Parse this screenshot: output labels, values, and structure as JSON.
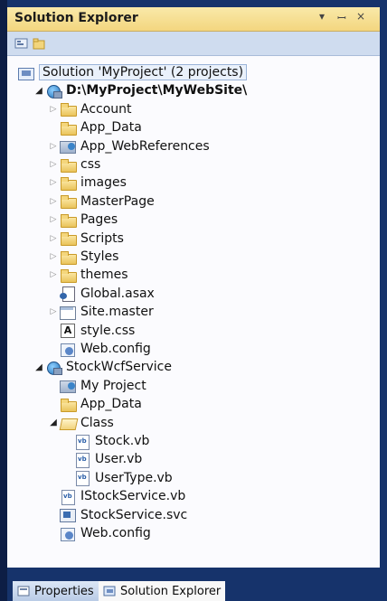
{
  "panel": {
    "title": "Solution Explorer",
    "controls": [
      "▾",
      "ꟷ",
      "×"
    ]
  },
  "toolbar": {
    "buttons": [
      "properties-icon",
      "show-all-files-icon"
    ]
  },
  "tree": {
    "items": [
      {
        "label": "Solution 'MyProject' (2 projects)",
        "level": 0,
        "icon": "solution-icon",
        "selected": true
      },
      {
        "label": "D:\\MyProject\\MyWebSite\\",
        "level": 1,
        "icon": "web-site-icon",
        "expanded": true,
        "bold": true
      },
      {
        "label": "Account",
        "level": 2,
        "icon": "folder-icon",
        "expandable": true
      },
      {
        "label": "App_Data",
        "level": 2,
        "icon": "folder-icon"
      },
      {
        "label": "App_WebReferences",
        "level": 2,
        "icon": "web-references-icon",
        "expandable": true
      },
      {
        "label": "css",
        "level": 2,
        "icon": "folder-icon",
        "expandable": true
      },
      {
        "label": "images",
        "level": 2,
        "icon": "folder-icon",
        "expandable": true
      },
      {
        "label": "MasterPage",
        "level": 2,
        "icon": "folder-icon",
        "expandable": true
      },
      {
        "label": "Pages",
        "level": 2,
        "icon": "folder-icon",
        "expandable": true
      },
      {
        "label": "Scripts",
        "level": 2,
        "icon": "folder-icon",
        "expandable": true
      },
      {
        "label": "Styles",
        "level": 2,
        "icon": "folder-icon",
        "expandable": true
      },
      {
        "label": "themes",
        "level": 2,
        "icon": "folder-icon",
        "expandable": true
      },
      {
        "label": "Global.asax",
        "level": 2,
        "icon": "asax-file-icon"
      },
      {
        "label": "Site.master",
        "level": 2,
        "icon": "master-file-icon",
        "expandable": true
      },
      {
        "label": "style.css",
        "level": 2,
        "icon": "css-file-icon"
      },
      {
        "label": "Web.config",
        "level": 2,
        "icon": "config-file-icon"
      },
      {
        "label": "StockWcfService",
        "level": 1,
        "icon": "wcf-project-icon",
        "expanded": true
      },
      {
        "label": "My Project",
        "level": 2,
        "icon": "my-project-icon"
      },
      {
        "label": "App_Data",
        "level": 2,
        "icon": "folder-icon"
      },
      {
        "label": "Class",
        "level": 2,
        "icon": "folder-open-icon",
        "expanded": true
      },
      {
        "label": "Stock.vb",
        "level": 3,
        "icon": "vb-file-icon"
      },
      {
        "label": "User.vb",
        "level": 3,
        "icon": "vb-file-icon"
      },
      {
        "label": "UserType.vb",
        "level": 3,
        "icon": "vb-file-icon"
      },
      {
        "label": "IStockService.vb",
        "level": 2,
        "icon": "vb-file-icon"
      },
      {
        "label": "StockService.svc",
        "level": 2,
        "icon": "svc-file-icon"
      },
      {
        "label": "Web.config",
        "level": 2,
        "icon": "config-file-icon"
      }
    ]
  },
  "tabs": [
    {
      "label": "Properties",
      "icon": "properties-tab-icon",
      "active": false
    },
    {
      "label": "Solution Explorer",
      "icon": "solution-explorer-tab-icon",
      "active": true
    }
  ]
}
